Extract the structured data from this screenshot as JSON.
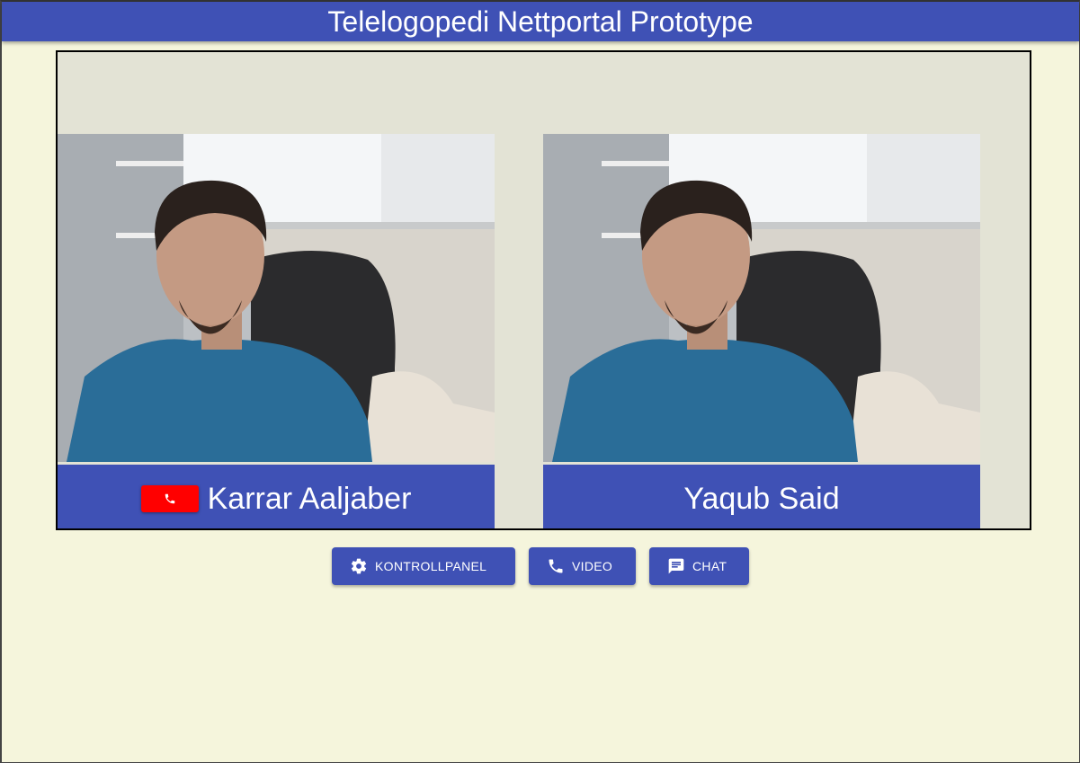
{
  "header": {
    "title": "Telelogopedi Nettportal Prototype"
  },
  "participants": [
    {
      "name": "Karrar Aaljaber",
      "has_hangup": true
    },
    {
      "name": "Yaqub Said",
      "has_hangup": false
    }
  ],
  "controls": {
    "settings_label": "KONTROLLPANEL",
    "video_label": "VIDEO",
    "chat_label": "CHAT"
  },
  "colors": {
    "primary": "#3f51b5",
    "background": "#f5f5dc",
    "panel": "#e3e3d5",
    "hangup": "#ff0000"
  },
  "icons": [
    "phone-icon",
    "gear-icon",
    "chat-icon",
    "hangup-icon"
  ]
}
